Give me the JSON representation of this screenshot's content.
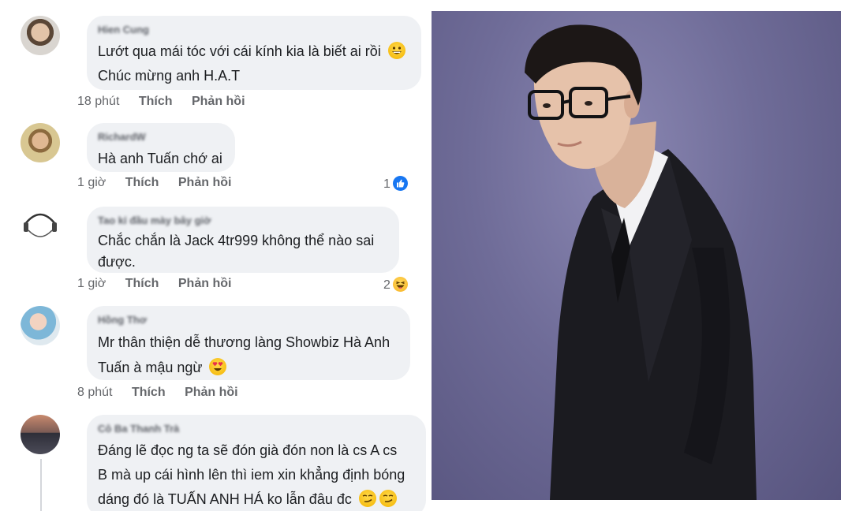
{
  "comments": [
    {
      "author": "Hien Cung",
      "lines": [
        "Lướt qua mái tóc với cái kính kia là biết ai rồi",
        "Chúc mừng anh H.A.T"
      ],
      "time": "18 phút",
      "like": "Thích",
      "reply": "Phản hồi",
      "reaction_count": "",
      "reaction_icon": "",
      "emoji": "grinning-face-icon"
    },
    {
      "author": "RichardW",
      "lines": [
        "Hà anh Tuấn chớ ai"
      ],
      "time": "1 giờ",
      "like": "Thích",
      "reply": "Phản hồi",
      "reaction_count": "1",
      "reaction_icon": "like-icon"
    },
    {
      "author": "Tao kỉ đầu mày bây giờ",
      "lines": [
        "Chắc chắn là Jack 4tr999 không thể nào sai",
        "được."
      ],
      "time": "1 giờ",
      "like": "Thích",
      "reply": "Phản hồi",
      "reaction_count": "2",
      "reaction_icon": "haha-icon"
    },
    {
      "author": "Hồng Thơ",
      "lines": [
        "Mr thân thiện dễ thương làng Showbiz Hà Anh",
        "Tuấn à mậu ngừ"
      ],
      "time": "8 phút",
      "like": "Thích",
      "reply": "Phản hồi",
      "reaction_count": "",
      "reaction_icon": "",
      "emoji": "heart-eyes-icon"
    },
    {
      "author": "Cô Ba Thanh Trà",
      "lines": [
        "Đáng lẽ đọc ng ta sẽ đón già đón non là cs A cs",
        "B mà up cái hình lên thì iem xin khẳng định bóng",
        "dáng đó là TUẤN ANH HÁ ko lẫn đâu đc"
      ],
      "emoji": "smirking-face-icon"
    }
  ],
  "colors": {
    "bubble": "#eff1f4",
    "meta_text": "#65676b",
    "like_blue": "#1877f2",
    "haha_yellow": "#f7b125",
    "photo_background": "#6f6c98"
  }
}
